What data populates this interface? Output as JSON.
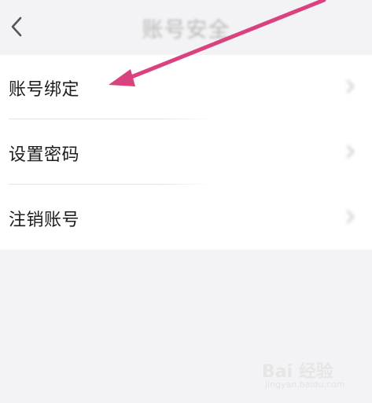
{
  "header": {
    "title": "账号安全",
    "back_icon": "chevron-left-icon"
  },
  "menu": {
    "items": [
      {
        "label": "账号绑定"
      },
      {
        "label": "设置密码"
      },
      {
        "label": "注销账号"
      }
    ]
  },
  "watermark": {
    "brand": "Bai 经验",
    "url": "jingyan.baidu.com"
  },
  "colors": {
    "annotation_arrow": "#d9417f",
    "background": "#f3f3f5",
    "card": "#ffffff"
  }
}
